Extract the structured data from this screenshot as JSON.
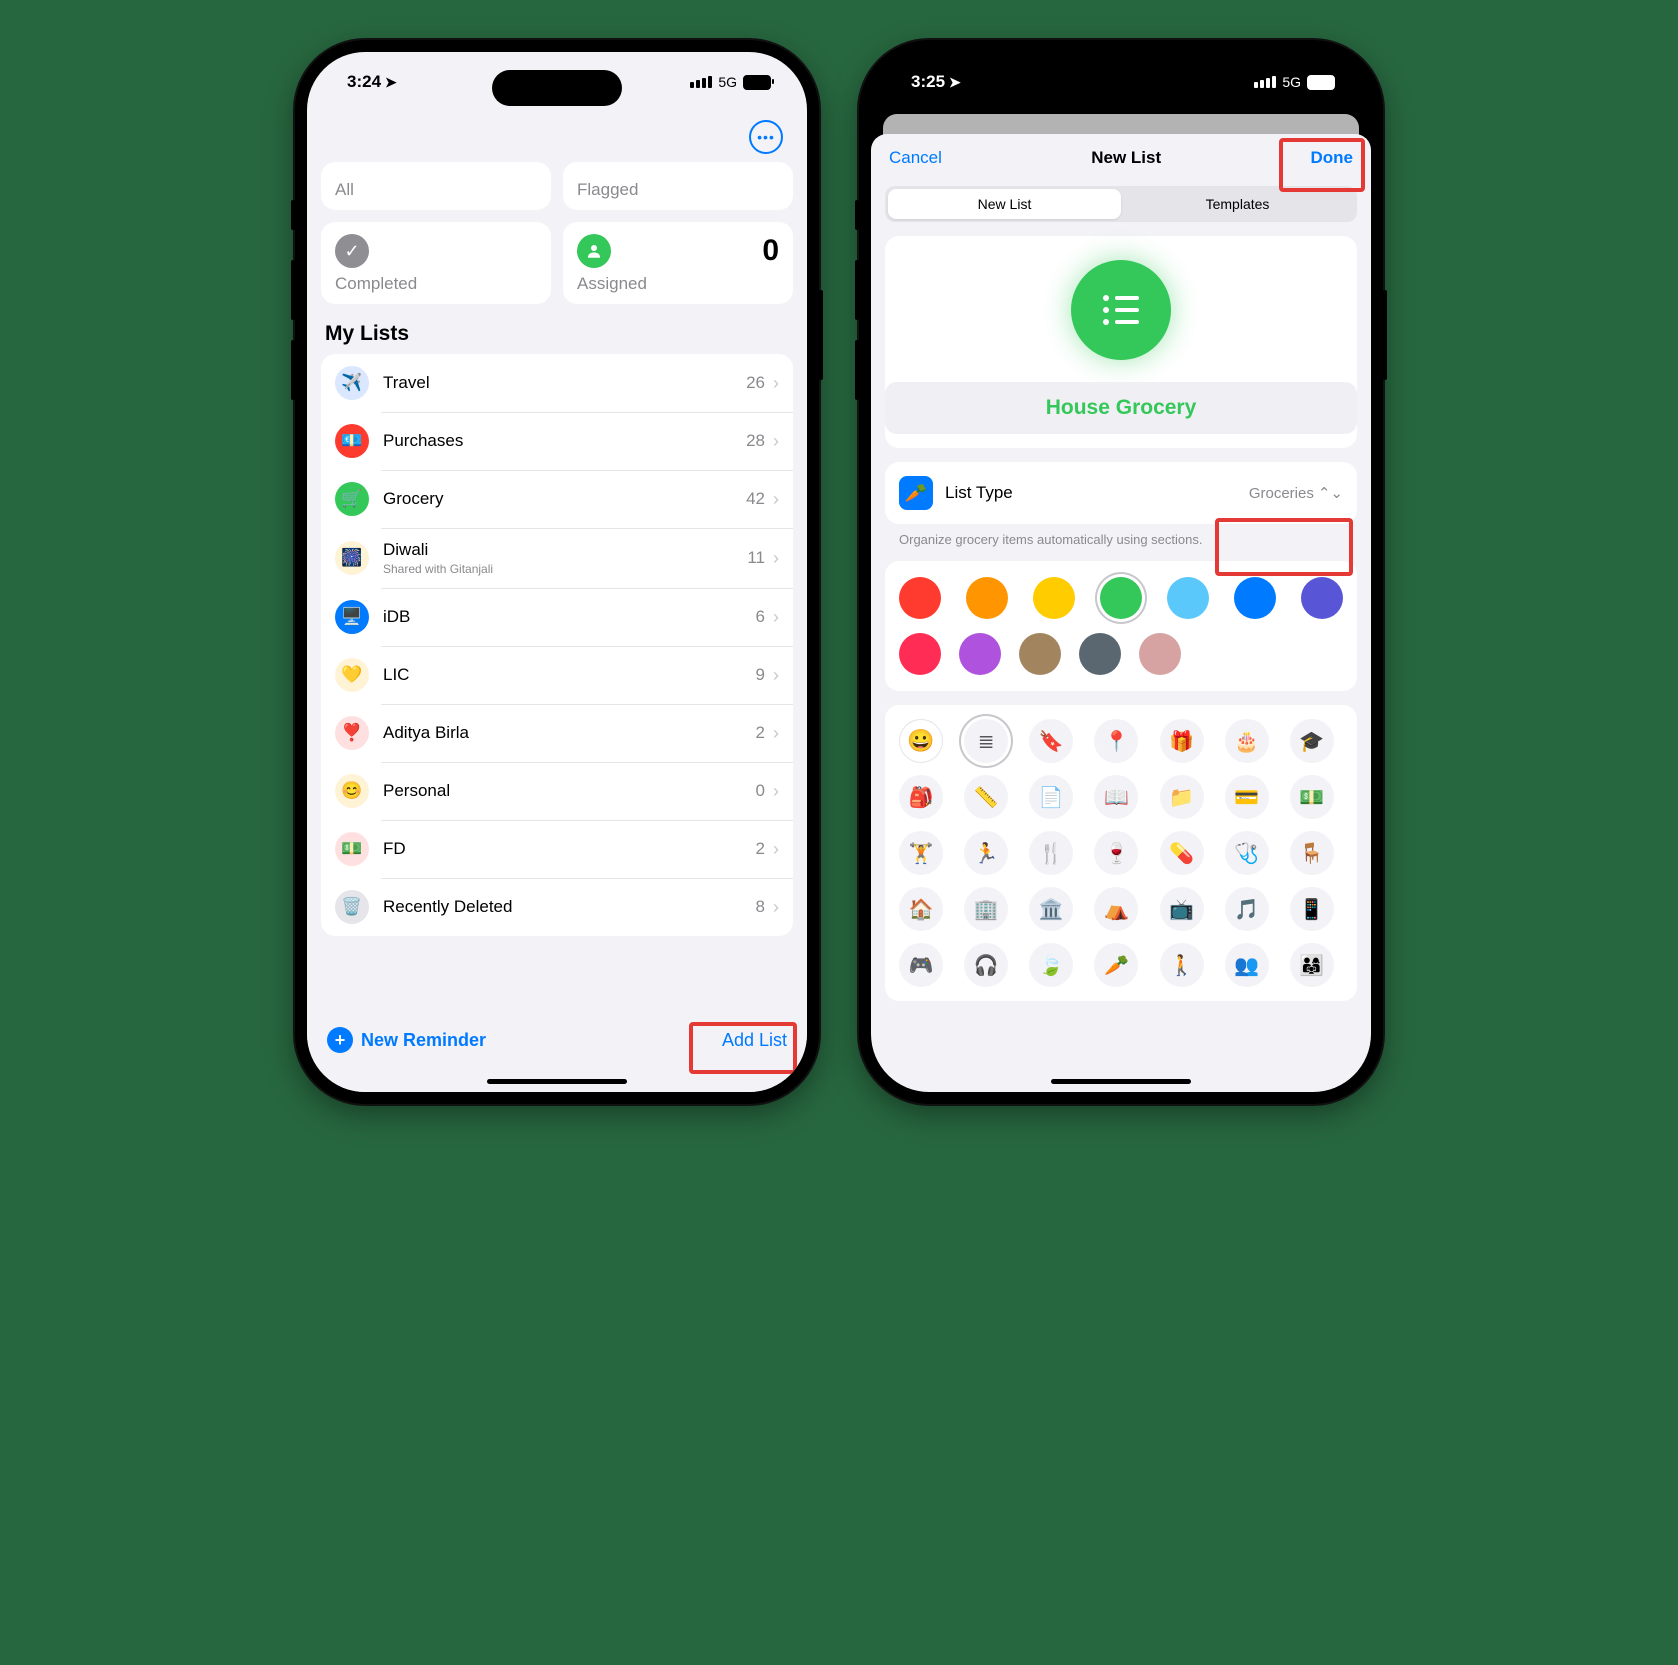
{
  "phone1": {
    "status": {
      "time": "3:24",
      "network": "5G"
    },
    "cards": {
      "all": {
        "label": "All"
      },
      "flagged": {
        "label": "Flagged"
      },
      "completed": {
        "label": "Completed"
      },
      "assigned": {
        "label": "Assigned",
        "count": "0"
      }
    },
    "section_title": "My Lists",
    "lists": [
      {
        "name": "Travel",
        "count": "26",
        "icon": "✈️",
        "bg": "#dbe7ff"
      },
      {
        "name": "Purchases",
        "count": "28",
        "icon": "💶",
        "bg": "#ff3b30",
        "color": "#fff"
      },
      {
        "name": "Grocery",
        "count": "42",
        "icon": "🛒",
        "bg": "#34c759",
        "color": "#fff"
      },
      {
        "name": "Diwali",
        "count": "11",
        "sub": "Shared with Gitanjali",
        "icon": "🎆",
        "bg": "#fff3d6"
      },
      {
        "name": "iDB",
        "count": "6",
        "icon": "🖥️",
        "bg": "#007aff",
        "color": "#fff"
      },
      {
        "name": "LIC",
        "count": "9",
        "icon": "💛",
        "bg": "#fff3d6"
      },
      {
        "name": "Aditya Birla",
        "count": "2",
        "icon": "❣️",
        "bg": "#ffe0e0"
      },
      {
        "name": "Personal",
        "count": "0",
        "icon": "😊",
        "bg": "#fff3d6"
      },
      {
        "name": "FD",
        "count": "2",
        "icon": "💵",
        "bg": "#ffe0e0"
      },
      {
        "name": "Recently Deleted",
        "count": "8",
        "icon": "🗑️",
        "bg": "#e5e5ea"
      }
    ],
    "footer": {
      "new_reminder": "New Reminder",
      "add_list": "Add List"
    }
  },
  "phone2": {
    "status": {
      "time": "3:25",
      "network": "5G"
    },
    "header": {
      "cancel": "Cancel",
      "title": "New List",
      "done": "Done"
    },
    "segments": {
      "new_list": "New List",
      "templates": "Templates"
    },
    "list_name": "House Grocery",
    "type": {
      "label": "List Type",
      "value": "Groceries"
    },
    "caption": "Organize grocery items automatically using sections.",
    "colors_row1": [
      "#ff3b30",
      "#ff9500",
      "#ffcc00",
      "#34c759",
      "#5ac8fa",
      "#007aff",
      "#5856d6"
    ],
    "colors_row2": [
      "#ff2d55",
      "#af52de",
      "#a2845e",
      "#5b6770",
      "#d6a2a2"
    ],
    "selected_color_index": 3,
    "icon_names": [
      "emoji",
      "list",
      "bookmark",
      "pin",
      "gift",
      "cake",
      "graduation",
      "backpack",
      "ruler",
      "document",
      "book",
      "folder",
      "card",
      "cash",
      "dumbbell",
      "running",
      "fork-knife",
      "wine",
      "pill",
      "stethoscope",
      "chair",
      "house",
      "building",
      "museum",
      "tent",
      "tv",
      "music",
      "phone",
      "game",
      "headphones",
      "leaf",
      "carrot",
      "person",
      "people",
      "family"
    ],
    "selected_icon_index": 1
  }
}
